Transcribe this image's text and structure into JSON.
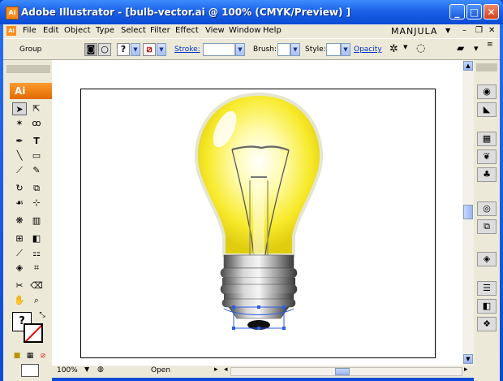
{
  "window": {
    "title": "Adobe Illustrator - [bulb-vector.ai @ 100% (CMYK/Preview) ]",
    "app_icon": "Ai",
    "controls": [
      "minimize",
      "maximize",
      "close"
    ]
  },
  "menu": {
    "items": [
      "File",
      "Edit",
      "Object",
      "Type",
      "Select",
      "Filter",
      "Effect",
      "View",
      "Window",
      "Help"
    ],
    "workspace": "MANJULA"
  },
  "control_bar": {
    "group_label": "Group",
    "stroke_label": "Stroke:",
    "brush_label": "Brush:",
    "style_label": "Style:",
    "opacity_label": "Opacity"
  },
  "tools": {
    "tab_label": "Ai",
    "icons": [
      "selection-tool-icon",
      "direct-selection-tool-icon",
      "magic-wand-icon",
      "lasso-icon",
      "pen-tool-icon",
      "type-tool-icon",
      "line-tool-icon",
      "rectangle-tool-icon",
      "paintbrush-icon",
      "pencil-icon",
      "rotate-icon",
      "scale-icon",
      "warp-icon",
      "free-transform-icon",
      "symbol-sprayer-icon",
      "graph-icon",
      "mesh-icon",
      "gradient-icon",
      "eyedropper-icon",
      "blend-icon",
      "live-paint-icon",
      "slice-icon",
      "scissors-icon",
      "eraser-icon",
      "hand-icon",
      "zoom-icon"
    ],
    "fill_stroke_glyph": "?"
  },
  "status_bar": {
    "zoom": "100%",
    "status_text": "Open"
  },
  "colors": {
    "title_bar": "#1c62e8",
    "accent_orange": "#ff8c1a",
    "bulb_yellow": "#fff25a",
    "selection_blue": "#2d5ce8"
  }
}
